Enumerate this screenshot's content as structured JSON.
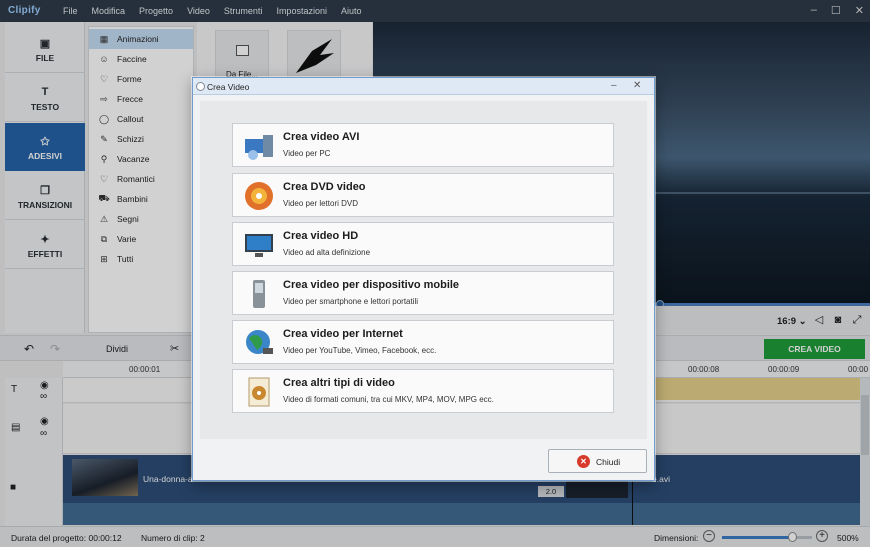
{
  "app": {
    "logo": "Clipify"
  },
  "menu": [
    "File",
    "Modifica",
    "Progetto",
    "Video",
    "Strumenti",
    "Impostazioni",
    "Aiuto"
  ],
  "window_controls": {
    "minimize": "–",
    "maximize": "☐",
    "close": "✕"
  },
  "categories": [
    {
      "label": "FILE",
      "icon": "image-icon",
      "glyph": "▣"
    },
    {
      "label": "TESTO",
      "icon": "text-icon",
      "glyph": "T"
    },
    {
      "label": "ADESIVI",
      "icon": "star-icon",
      "glyph": "✩",
      "active": true
    },
    {
      "label": "TRANSIZIONI",
      "icon": "transition-icon",
      "glyph": "❐"
    },
    {
      "label": "EFFETTI",
      "icon": "magic-wand-icon",
      "glyph": "✦"
    }
  ],
  "subcategories": [
    {
      "label": "Animazioni",
      "glyph": "▦",
      "active": true
    },
    {
      "label": "Faccine",
      "glyph": "☺"
    },
    {
      "label": "Forme",
      "glyph": "♡"
    },
    {
      "label": "Frecce",
      "glyph": "⇨"
    },
    {
      "label": "Callout",
      "glyph": "◯"
    },
    {
      "label": "Schizzi",
      "glyph": "✎"
    },
    {
      "label": "Vacanze",
      "glyph": "⚲"
    },
    {
      "label": "Romantici",
      "glyph": "♡"
    },
    {
      "label": "Bambini",
      "glyph": "⛟"
    },
    {
      "label": "Segni",
      "glyph": "⚠"
    },
    {
      "label": "Varie",
      "glyph": "⧉"
    },
    {
      "label": "Tutti",
      "glyph": "⊞"
    }
  ],
  "stickers": {
    "from_file": "Da File..."
  },
  "preview": {
    "ratio": "16:9 ⌄"
  },
  "toolbar": {
    "undo": "↶",
    "redo": "↷",
    "split": "Dividi",
    "cut": "✂",
    "create": "CREA VIDEO"
  },
  "ruler": {
    "ticks": [
      "00:00:01",
      "00:00:08",
      "00:00:09",
      "00:00"
    ]
  },
  "tracks": {
    "clip1": "Una-donna-a",
    "clip2": "e.avi",
    "badge": "2.0"
  },
  "status": {
    "duration": "Durata del progetto:   00:00:12",
    "clips": "Numero di clip: 2",
    "dimensions": "Dimensioni:",
    "zoom": "500%"
  },
  "dialog": {
    "title": "Crea Video",
    "options": [
      {
        "title": "Crea video AVI",
        "subtitle": "Video per PC",
        "icon": "computer-icon",
        "color": "#3b78c2"
      },
      {
        "title": "Crea DVD video",
        "subtitle": "Video per lettori DVD",
        "icon": "dvd-icon",
        "color": "#e0702a"
      },
      {
        "title": "Crea video HD",
        "subtitle": "Video ad alta definizione",
        "icon": "monitor-icon",
        "color": "#2e7fc8"
      },
      {
        "title": "Crea video per dispositivo mobile",
        "subtitle": "Video per smartphone e lettori portatili",
        "icon": "phone-icon",
        "color": "#8a9299"
      },
      {
        "title": "Crea video per Internet",
        "subtitle": "Video per YouTube, Vimeo, Facebook, ecc.",
        "icon": "globe-icon",
        "color": "#2f9b4a"
      },
      {
        "title": "Crea altri tipi di video",
        "subtitle": "Video di formati comuni, tra cui MKV, MP4, MOV, MPG ecc.",
        "icon": "film-file-icon",
        "color": "#c9872f"
      }
    ],
    "close_button": "Chiudi"
  }
}
